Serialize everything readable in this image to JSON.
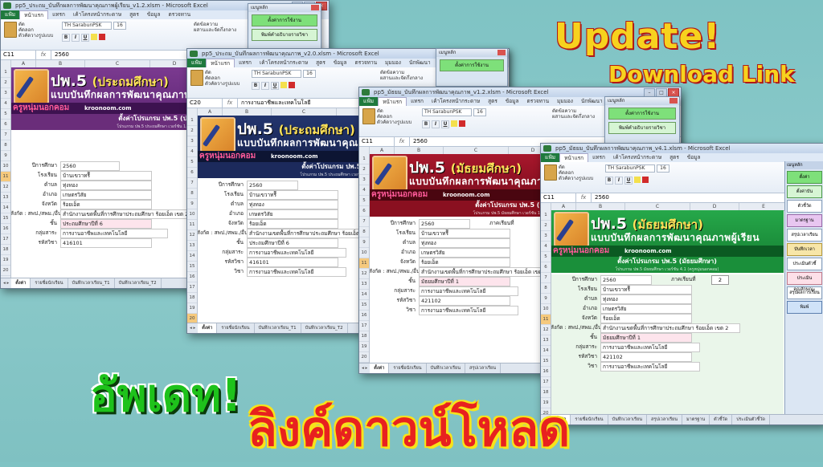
{
  "overlay": {
    "update_en": "Update!",
    "download_en": "Download Link",
    "update_th": "อัพเดท!",
    "download_th": "ลิงค์ดาวน์โหลด"
  },
  "ribbon_common": {
    "tab_file": "แฟ้ม",
    "tab_home": "หน้าแรก",
    "tab_insert": "แทรก",
    "tab_layout": "เค้าโครงหน้ากระดาษ",
    "tab_formulas": "สูตร",
    "tab_data": "ข้อมูล",
    "tab_review": "ตรวจทาน",
    "tab_view": "มุมมอง",
    "tab_dev": "นักพัฒนา",
    "cut": "ตัด",
    "copy": "คัดลอก",
    "format_painter": "ตัวคัดวางรูปแบบ",
    "paste": "วาง",
    "font": "TH SarabunPSK",
    "size": "16",
    "wrap": "ตัดข้อความ",
    "merge": "ผสานและจัดกึ่งกลาง"
  },
  "panel": {
    "title": "เมนูหลัก",
    "btn1": "ตั้งค่าการใช้งาน",
    "btn2": "พิมพ์คำอธิบายรายวิชา",
    "btn3": "รายชื่อนักเรียน"
  },
  "windows": [
    {
      "title": "pp5_ประถม_บันทึกผลการพัฒนาคุณภาพผู้เรียน_v1.2.xlsm - Microsoft Excel",
      "cell": "C11",
      "formula": "2560",
      "program": "ปพ.5",
      "level": "(ประถมศึกษา)",
      "subtitle": "แบบบันทึกผลการพัฒนาคุณภาพผู้เรียน",
      "kru": "ครูหนุ่มนอกคอม",
      "site": "kroonoom.com",
      "settings": "ตั้งค่าโปรแกรม ปพ.5 (ประถมศึกษา)",
      "note": "โปรแกรม ปพ.5 ประถมศึกษา เวอร์ชัน 1.2 (ครูหนุ่มนอกคอม)",
      "fields": [
        {
          "label": "ปีการศึกษา",
          "value": "2560"
        },
        {
          "label": "โรงเรียน",
          "value": "บ้านเขวาทรีี"
        },
        {
          "label": "ตำบล",
          "value": "ทุ่งทอง"
        },
        {
          "label": "อำเภอ",
          "value": "เกษตรวิสัย"
        },
        {
          "label": "จังหวัด",
          "value": "ร้อยเอ็ด"
        },
        {
          "label": "สังกัด : สพป./สพม./อื่นๆ",
          "value": "สำนักงานเขตพื้นที่การศึกษาประถมศึกษา ร้อยเอ็ด เขต 2"
        },
        {
          "label": "ชั้น",
          "value": "ประถมศึกษาปีที่ 6"
        },
        {
          "label": "กลุ่มสาระ",
          "value": "การงานอาชีพและเทคโนโลยี"
        },
        {
          "label": "รหัสวิชา",
          "value": "416101"
        },
        {
          "label": "วิชา",
          "value": "การงานอาชีพและเทคโนโลยี"
        }
      ],
      "sheets": [
        "ตั้งค่า",
        "รายชื่อนักเรียน",
        "บันทึกเวลาเรียน_T1",
        "บันทึกเวลาเรียน_T2"
      ]
    },
    {
      "title": "pp5_ประถม_บันทึกผลการพัฒนาคุณภาพ_v2.0.xlsm - Microsoft Excel",
      "cell": "C20",
      "formula": "การงานอาชีพและเทคโนโลยี",
      "program": "ปพ.5",
      "level": "(ประถมศึกษา)",
      "subtitle": "แบบบันทึกผลการพัฒนาคุณภาพผู้เรียน",
      "kru": "ครูหนุ่มนอกคอม",
      "site": "kroonoom.com",
      "settings": "ตั้งค่าโปรแกรม ปพ.5 (ประถมศึกษา)",
      "note": "โปรแกรม ปพ.5 ประถมศึกษา เวอร์ชัน 2.0 (ครูหนุ่มนอกคอม)",
      "fields": [
        {
          "label": "ปีการศึกษา",
          "value": "2560"
        },
        {
          "label": "โรงเรียน",
          "value": "บ้านเขวาทรีี"
        },
        {
          "label": "ตำบล",
          "value": "ทุ่งทอง"
        },
        {
          "label": "อำเภอ",
          "value": "เกษตรวิสัย"
        },
        {
          "label": "จังหวัด",
          "value": "ร้อยเอ็ด"
        },
        {
          "label": "สังกัด : สพป./สพม./อื่นๆ",
          "value": "สำนักงานเขตพื้นที่การศึกษาประถมศึกษา ร้อยเอ็ด"
        },
        {
          "label": "ชั้น",
          "value": "ประถมศึกษาปีที่ 6"
        },
        {
          "label": "กลุ่มสาระ",
          "value": "การงานอาชีพและเทคโนโลยี"
        },
        {
          "label": "รหัสวิชา",
          "value": "416101"
        },
        {
          "label": "วิชา",
          "value": "การงานอาชีพและเทคโนโลยี"
        }
      ],
      "sheets": [
        "ตั้งค่า",
        "รายชื่อนักเรียน",
        "บันทึกเวลาเรียน_T1",
        "บันทึกเวลาเรียน_T2"
      ]
    },
    {
      "title": "pp5_มัธยม_บันทึกผลการพัฒนาคุณภาพ_v1.2.xlsm - Microsoft Excel",
      "cell": "C11",
      "formula": "2560",
      "program": "ปพ.5",
      "level": "(มัธยมศึกษา)",
      "subtitle": "แบบบันทึกผลการพัฒนาคุณภาพผู้เรียน",
      "kru": "ครูหนุ่มนอกคอม",
      "site": "kroonoom.com",
      "settings": "ตั้งค่าโปรแกรม ปพ.5 (มัธยมศึกษา)",
      "note": "โปรแกรม ปพ.5 มัธยมศึกษา เวอร์ชัน 1.2 (ครูหนุ่มนอกคอม)",
      "semester_label": "ภาคเรียนที่",
      "fields": [
        {
          "label": "ปีการศึกษา",
          "value": "2560"
        },
        {
          "label": "โรงเรียน",
          "value": "บ้านเขวาทรีี"
        },
        {
          "label": "ตำบล",
          "value": "ทุ่งทอง"
        },
        {
          "label": "อำเภอ",
          "value": "เกษตรวิสัย"
        },
        {
          "label": "จังหวัด",
          "value": "ร้อยเอ็ด"
        },
        {
          "label": "สังกัด : สพป./สพม./อื่นๆ",
          "value": "สำนักงานเขตพื้นที่การศึกษาประถมศึกษา ร้อยเอ็ด เขต 2"
        },
        {
          "label": "ชั้น",
          "value": "มัธยมศึกษาปีที่ 1"
        },
        {
          "label": "กลุ่มสาระ",
          "value": "การงานอาชีพและเทคโนโลยี"
        },
        {
          "label": "รหัสวิชา",
          "value": "421102"
        },
        {
          "label": "วิชา",
          "value": "การงานอาชีพและเทคโนโลยี"
        }
      ],
      "sheets": [
        "ตั้งค่า",
        "รายชื่อนักเรียน",
        "บันทึกเวลาเรียน",
        "สรุปเวลาเรียน"
      ]
    },
    {
      "title": "pp5_มัธยม_บันทึกผลการพัฒนาคุณภาพ_v4.1.xlsm - Microsoft Excel",
      "cell": "C11",
      "formula": "2560",
      "program": "ปพ.5",
      "level": "(มัธยมศึกษา)",
      "subtitle": "แบบบันทึกผลการพัฒนาคุณภาพผู้เรียน",
      "kru": "ครูหนุ่มนอกคอม",
      "site": "kroonoom.com",
      "settings": "ตั้งค่าโปรแกรม ปพ.5 (มัธยมศึกษา)",
      "note": "โปรแกรม ปพ.5 มัธยมศึกษา เวอร์ชัน 4.1 (ครูหนุ่มนอกคอม)",
      "semester_label": "ภาคเรียนที่",
      "semester": "2",
      "fields": [
        {
          "label": "ปีการศึกษา",
          "value": "2560"
        },
        {
          "label": "โรงเรียน",
          "value": "บ้านเขวาทรีี"
        },
        {
          "label": "ตำบล",
          "value": "ทุ่งทอง"
        },
        {
          "label": "อำเภอ",
          "value": "เกษตรวิสัย"
        },
        {
          "label": "จังหวัด",
          "value": "ร้อยเอ็ด"
        },
        {
          "label": "สังกัด : สพป./สพม./อื่นๆ",
          "value": "สำนักงานเขตพื้นที่การศึกษาประถมศึกษา ร้อยเอ็ด เขต 2"
        },
        {
          "label": "ชั้น",
          "value": "มัธยมศึกษาปีที่ 1"
        },
        {
          "label": "กลุ่มสาระ",
          "value": "การงานอาชีพและเทคโนโลยี"
        },
        {
          "label": "รหัสวิชา",
          "value": "421102"
        },
        {
          "label": "วิชา",
          "value": "การงานอาชีพและเทคโนโลยี"
        }
      ],
      "sheets": [
        "ตั้งค่า",
        "รายชื่อนักเรียน",
        "บันทึกเวลาเรียน",
        "สรุปเวลาเรียน",
        "มาตรฐาน",
        "ตัวชี้วัด",
        "ประเมินตัวชี้วัด"
      ]
    }
  ],
  "sidebar_menu": {
    "title": "เมนูหลัก",
    "items": [
      "ตั้งค่า",
      "ตั้งค่าบัน",
      "ตัวชี้วัด",
      "มาตรฐาน",
      "สรุปเวลาเรียน",
      "บันทึกเวลา",
      "ประเมินตัวชี้",
      "ประเมินคุณลักษณะ",
      "สรุปผลการเรียน",
      "พิมพ์"
    ]
  },
  "colors": {
    "win1_banner": "#6a2d7a",
    "win2_banner": "#1c2a5c",
    "win3_banner": "#8a1020",
    "win4_banner": "#1a8f3a",
    "update_yellow": "#f7d21e",
    "thai_green": "#1ec21b",
    "thai_red": "#e8211f"
  }
}
